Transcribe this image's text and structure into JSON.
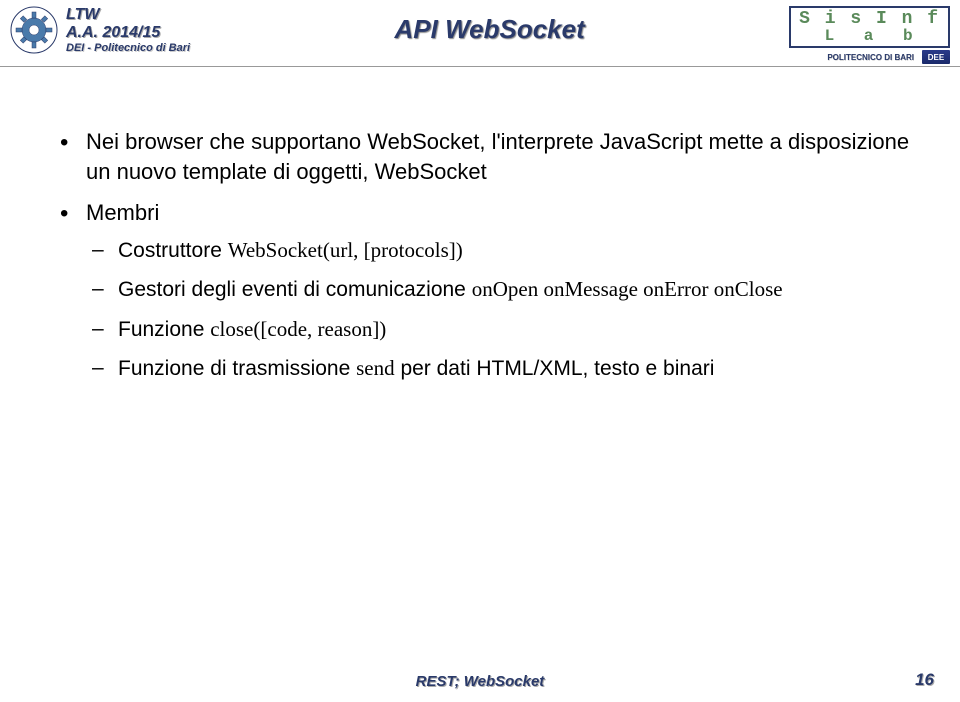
{
  "header": {
    "left": {
      "line1": "LTW",
      "line2": "A.A. 2014/15",
      "line3": "DEI - Politecnico di Bari"
    },
    "title": "API WebSocket",
    "right": {
      "sisinf_top": "S i s I n f",
      "sisinf_bottom": "L a b",
      "poli": "POLITECNICO DI BARI",
      "dee": "DEE"
    }
  },
  "content": {
    "bullets": [
      {
        "text": "Nei browser che supportano WebSocket, l'interprete JavaScript mette a disposizione un nuovo template di oggetti, WebSocket"
      },
      {
        "text": "Membri",
        "subs": [
          {
            "prefix": "Costruttore ",
            "code": "WebSocket(url, [protocols])"
          },
          {
            "prefix": "Gestori degli eventi di comunicazione ",
            "code": "onOpen  onMessage onError onClose"
          },
          {
            "prefix": "Funzione ",
            "code": "close([code, reason])"
          },
          {
            "prefix": "Funzione di trasmissione ",
            "code": "send",
            "suffix": " per dati HTML/XML, testo e binari"
          }
        ]
      }
    ]
  },
  "footer": {
    "title": "REST; WebSocket",
    "page": "16"
  }
}
